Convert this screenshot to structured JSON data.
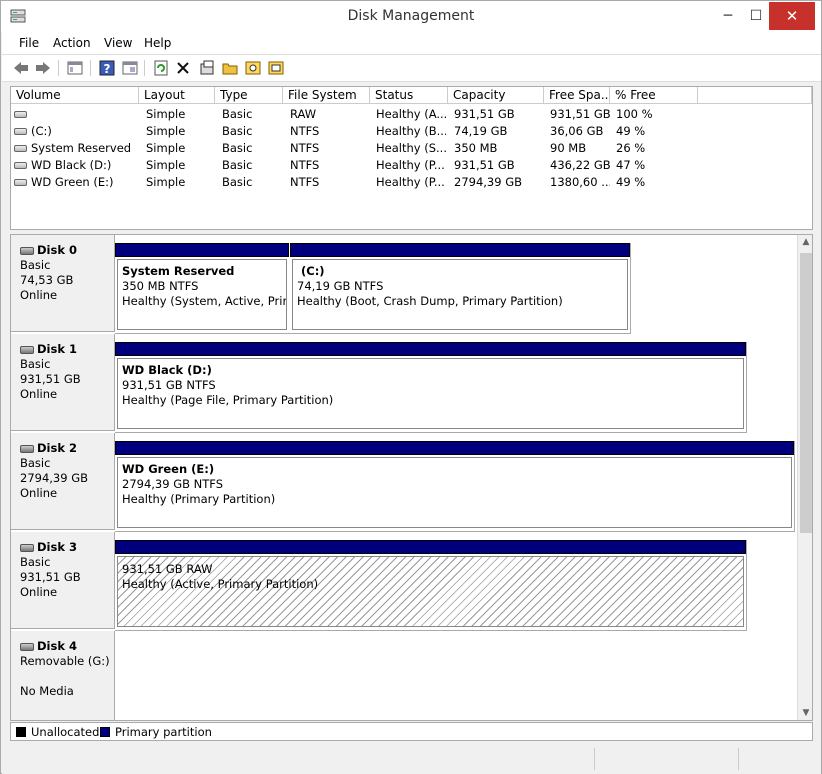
{
  "window": {
    "title": "Disk Management",
    "minimize": "─",
    "maximize": "☐",
    "close": "✕"
  },
  "menu": [
    "File",
    "Action",
    "View",
    "Help"
  ],
  "toolbar": [
    "back-icon",
    "forward-icon",
    "console-tree-icon",
    "help-icon",
    "properties-view-icon",
    "refresh-icon",
    "delete-icon",
    "properties-icon",
    "open-icon",
    "explore-icon",
    "disk-settings-icon"
  ],
  "volume_columns": [
    "Volume",
    "Layout",
    "Type",
    "File System",
    "Status",
    "Capacity",
    "Free Spa...",
    "% Free"
  ],
  "volumes": [
    [
      "",
      "Simple",
      "Basic",
      "RAW",
      "Healthy (A...",
      "931,51 GB",
      "931,51 GB",
      "100 %"
    ],
    [
      "(C:)",
      "Simple",
      "Basic",
      "NTFS",
      "Healthy (B...",
      "74,19 GB",
      "36,06 GB",
      "49 %"
    ],
    [
      "System Reserved",
      "Simple",
      "Basic",
      "NTFS",
      "Healthy (S...",
      "350 MB",
      "90 MB",
      "26 %"
    ],
    [
      "WD Black (D:)",
      "Simple",
      "Basic",
      "NTFS",
      "Healthy (P...",
      "931,51 GB",
      "436,22 GB",
      "47 %"
    ],
    [
      "WD Green (E:)",
      "Simple",
      "Basic",
      "NTFS",
      "Healthy (P...",
      "2794,39 GB",
      "1380,60 ...",
      "49 %"
    ]
  ],
  "disks": [
    {
      "name": "Disk 0",
      "type": "Basic",
      "size": "74,53 GB",
      "status": "Online"
    },
    {
      "name": "Disk 1",
      "type": "Basic",
      "size": "931,51 GB",
      "status": "Online"
    },
    {
      "name": "Disk 2",
      "type": "Basic",
      "size": "2794,39 GB",
      "status": "Online"
    },
    {
      "name": "Disk 3",
      "type": "Basic",
      "size": "931,51 GB",
      "status": "Online"
    },
    {
      "name": "Disk 4",
      "type": "Removable (G:)",
      "size": "",
      "status": "No Media"
    }
  ],
  "partitions": {
    "d0p0": {
      "title": "System Reserved",
      "size": "350 MB NTFS",
      "status": "Healthy (System, Active, Primary Partition)"
    },
    "d0p1": {
      "title": "(C:)",
      "size": "74,19 GB NTFS",
      "status": "Healthy (Boot, Crash Dump, Primary Partition)"
    },
    "d1p0": {
      "title": "WD Black  (D:)",
      "size": "931,51 GB NTFS",
      "status": "Healthy (Page File, Primary Partition)"
    },
    "d2p0": {
      "title": "WD Green  (E:)",
      "size": "2794,39 GB NTFS",
      "status": "Healthy (Primary Partition)"
    },
    "d3p0": {
      "title": "",
      "size": "931,51 GB RAW",
      "status": "Healthy (Active, Primary Partition)"
    }
  },
  "legend": {
    "unallocated": "Unallocated",
    "primary": "Primary partition",
    "unallocated_color": "#000000",
    "primary_color": "#00007f"
  }
}
